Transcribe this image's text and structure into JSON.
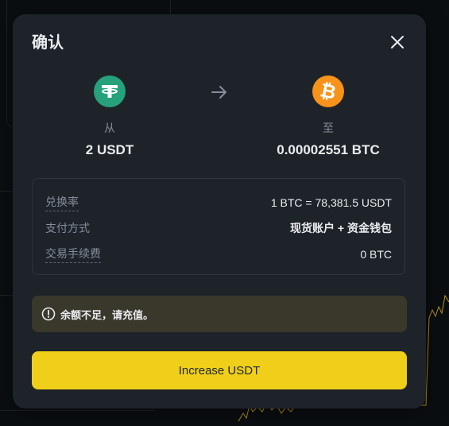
{
  "dialog": {
    "title": "确认"
  },
  "conversion": {
    "from": {
      "label": "从",
      "amount": "2 USDT",
      "coin_icon": "usdt-tether-icon",
      "coin_color": "#26a17b"
    },
    "to": {
      "label": "至",
      "amount": "0.00002551 BTC",
      "coin_icon": "btc-bitcoin-icon",
      "coin_color": "#f7931a"
    }
  },
  "details": [
    {
      "label": "兑换率",
      "value": "1 BTC = 78,381.5 USDT"
    },
    {
      "label": "支付方式",
      "value": "现货账户 + 资金钱包"
    },
    {
      "label": "交易手续费",
      "value": "0 BTC"
    }
  ],
  "warning": {
    "text": "余额不足，请充值。"
  },
  "action": {
    "label": "Increase USDT"
  },
  "colors": {
    "accent": "#f0cf1a",
    "modal_bg": "#1e2329",
    "warning_bg": "#3a372b",
    "text_primary": "#eaecef",
    "text_secondary": "#848e9c"
  }
}
